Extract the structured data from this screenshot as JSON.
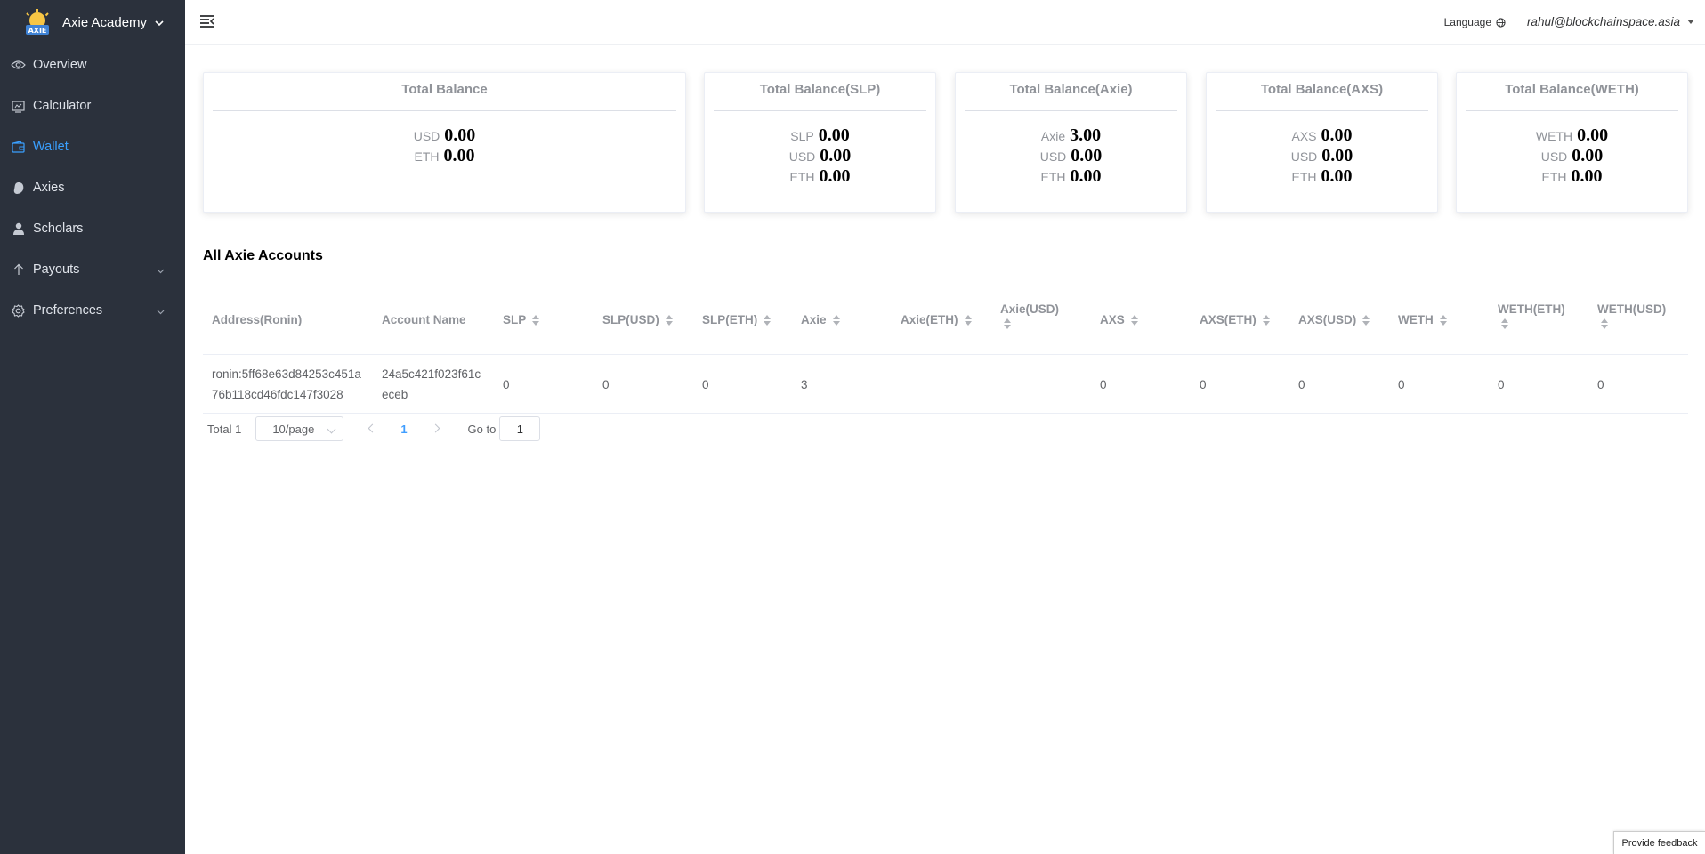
{
  "brand": {
    "title": "Axie Academy"
  },
  "colors": {
    "sidebar_bg": "#2b313c",
    "active": "#3aa0ff",
    "page_active": "#409eff"
  },
  "sidebar": {
    "items": [
      {
        "label": "Overview",
        "icon": "eye-icon"
      },
      {
        "label": "Calculator",
        "icon": "calculator-icon"
      },
      {
        "label": "Wallet",
        "icon": "wallet-icon",
        "active": true
      },
      {
        "label": "Axies",
        "icon": "axie-icon"
      },
      {
        "label": "Scholars",
        "icon": "person-icon"
      },
      {
        "label": "Payouts",
        "icon": "arrow-up-icon",
        "expandable": true
      },
      {
        "label": "Preferences",
        "icon": "gear-icon",
        "expandable": true
      }
    ]
  },
  "header": {
    "language_label": "Language",
    "user_email": "rahul@blockchainspace.asia"
  },
  "cards": [
    {
      "title": "Total Balance",
      "lines": [
        {
          "unit": "USD",
          "value": "0.00"
        },
        {
          "unit": "ETH",
          "value": "0.00"
        }
      ]
    },
    {
      "title": "Total Balance(SLP)",
      "lines": [
        {
          "unit": "SLP",
          "value": "0.00"
        },
        {
          "unit": "USD",
          "value": "0.00"
        },
        {
          "unit": "ETH",
          "value": "0.00"
        }
      ]
    },
    {
      "title": "Total Balance(Axie)",
      "lines": [
        {
          "unit": "Axie",
          "value": "3.00"
        },
        {
          "unit": "USD",
          "value": "0.00"
        },
        {
          "unit": "ETH",
          "value": "0.00"
        }
      ]
    },
    {
      "title": "Total Balance(AXS)",
      "lines": [
        {
          "unit": "AXS",
          "value": "0.00"
        },
        {
          "unit": "USD",
          "value": "0.00"
        },
        {
          "unit": "ETH",
          "value": "0.00"
        }
      ]
    },
    {
      "title": "Total Balance(WETH)",
      "lines": [
        {
          "unit": "WETH",
          "value": "0.00"
        },
        {
          "unit": "USD",
          "value": "0.00"
        },
        {
          "unit": "ETH",
          "value": "0.00"
        }
      ]
    }
  ],
  "section": {
    "title": "All Axie Accounts"
  },
  "table": {
    "columns": [
      "Address(Ronin)",
      "Account Name",
      "SLP",
      "SLP(USD)",
      "SLP(ETH)",
      "Axie",
      "Axie(ETH)",
      "Axie(USD)",
      "AXS",
      "AXS(ETH)",
      "AXS(USD)",
      "WETH",
      "WETH(ETH)",
      "WETH(USD)"
    ],
    "rows": [
      [
        "ronin:5ff68e63d84253c451a76b118cd46fdc147f3028",
        "24a5c421f023f61ceceb",
        "0",
        "0",
        "0",
        "3",
        "",
        "",
        "0",
        "0",
        "0",
        "0",
        "0",
        "0"
      ]
    ]
  },
  "pagination": {
    "total_label": "Total 1",
    "page_size": "10/page",
    "current_page": "1",
    "goto_label": "Go to",
    "goto_value": "1"
  },
  "feedback": {
    "label": "Provide feedback"
  }
}
